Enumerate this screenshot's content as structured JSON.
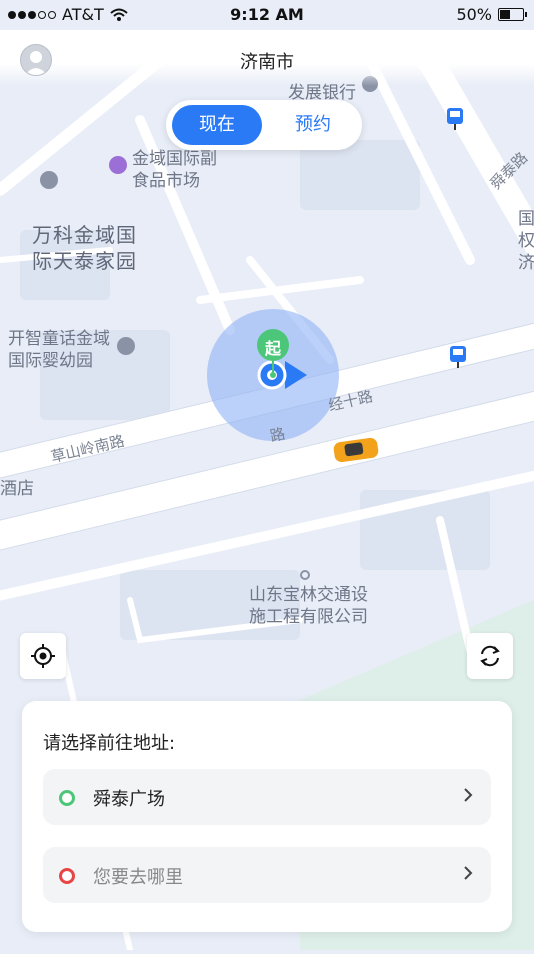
{
  "status_bar": {
    "carrier": "AT&T",
    "time": "9:12 AM",
    "battery": "50%",
    "battery_level": 0.5
  },
  "header": {
    "city": "济南市"
  },
  "mode_toggle": {
    "now": "现在",
    "reserve": "预约"
  },
  "map": {
    "pois": [
      "发展银行",
      "金域国际副\n食品市场",
      "万科金域国\n际天泰家园",
      "开智童话金域\n国际婴幼园",
      "山东宝林交通设\n施工程有限公司",
      "酒店",
      "国\n权\n济"
    ],
    "roads": [
      "草山岭南路",
      "经十路",
      "舜泰路",
      "路"
    ],
    "start_pin": "起"
  },
  "panel": {
    "title": "请选择前往地址:",
    "start": {
      "text": "舜泰广场",
      "color": "#4cc77a"
    },
    "destination": {
      "placeholder": "您要去哪里",
      "color": "#e84545"
    }
  },
  "colors": {
    "accent": "#2b7af5",
    "taxi": "#f2a21b"
  },
  "icons": [
    "avatar-icon",
    "locate-icon",
    "refresh-icon",
    "bus-stop-icon",
    "chevron-right-icon",
    "taxi-icon"
  ]
}
